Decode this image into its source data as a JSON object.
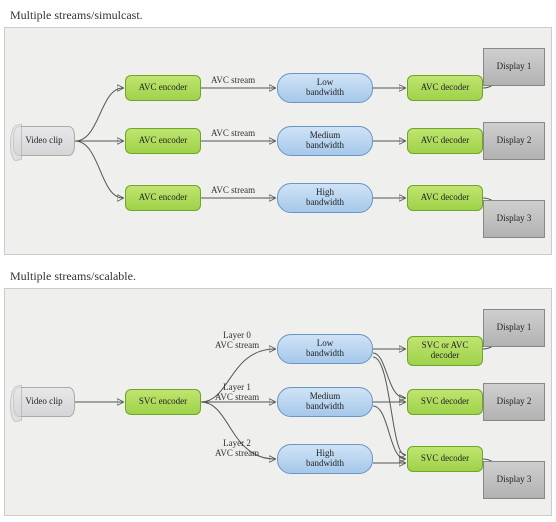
{
  "sections": {
    "simulcast": {
      "title": "Multiple streams/simulcast.",
      "source": "Video clip",
      "encoders": [
        "AVC encoder",
        "AVC encoder",
        "AVC encoder"
      ],
      "stream_labels": [
        "AVC stream",
        "AVC stream",
        "AVC stream"
      ],
      "bandwidths": [
        "Low\nbandwidth",
        "Medium\nbandwidth",
        "High\nbandwidth"
      ],
      "decoders": [
        "AVC decoder",
        "AVC decoder",
        "AVC decoder"
      ],
      "displays": [
        "Display 1",
        "Display 2",
        "Display 3"
      ]
    },
    "scalable": {
      "title": "Multiple streams/scalable.",
      "source": "Video clip",
      "encoder": "SVC encoder",
      "layer_labels": [
        "Layer 0\nAVC stream",
        "Layer 1\nAVC stream",
        "Layer 2\nAVC stream"
      ],
      "bandwidths": [
        "Low\nbandwidth",
        "Medium\nbandwidth",
        "High\nbandwidth"
      ],
      "decoders": [
        "SVC or AVC\ndecoder",
        "SVC decoder",
        "SVC decoder"
      ],
      "displays": [
        "Display 1",
        "Display 2",
        "Display 3"
      ]
    }
  }
}
